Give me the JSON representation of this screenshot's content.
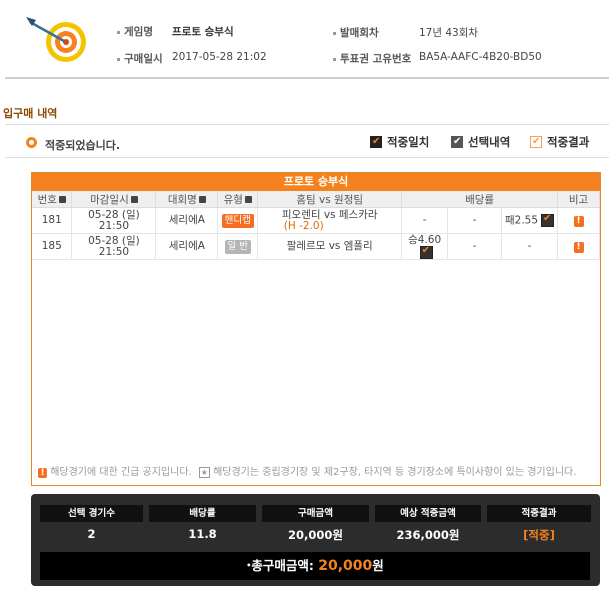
{
  "header": {
    "game_name_label": "게임명",
    "game_name": "프로토 승부식",
    "issue_label": "발매회차",
    "issue_value": "17년 43회차",
    "purchase_date_label": "구매일시",
    "purchase_date": "2017-05-28 21:02",
    "ticket_id_label": "투표권 고유번호",
    "ticket_id": "BA5A-AAFC-4B20-BD50"
  },
  "section": {
    "title": "입구매 내역",
    "status_text": "적중되었습니다."
  },
  "legend": {
    "hit_match": "적중일치",
    "selected": "선택내역",
    "hit_result": "적중결과",
    "colors": {
      "hit_match": "#222222",
      "selected": "#555555",
      "hit_result": "#f5a14f"
    }
  },
  "table": {
    "title": "프로토 승부식",
    "columns": [
      "번호",
      "마감일시",
      "대회명",
      "유형",
      "홈팀 vs 원정팀",
      "배당률",
      "비고"
    ],
    "rows": [
      {
        "no": "181",
        "date": "05-28 (일)",
        "time": "21:50",
        "league": "세리에A",
        "type": "핸디캡",
        "type_color": "#f36f21",
        "home": "피오렌티",
        "handicap": "(H -2.0)",
        "vs": "vs",
        "away": "페스카라",
        "odds_win": "-",
        "odds_draw": "-",
        "odds_lose": "패2.55",
        "selected_col": "lose"
      },
      {
        "no": "185",
        "date": "05-28 (일)",
        "time": "21:50",
        "league": "세리에A",
        "type": "일 반",
        "type_color": "#b5b5b5",
        "home": "팔레르모",
        "handicap": "",
        "vs": "vs",
        "away": "엠폴리",
        "odds_win": "승4.60",
        "odds_draw": "-",
        "odds_lose": "-",
        "selected_col": "win"
      }
    ],
    "notice1": "해당경기에 대한 긴급 공지입니다.",
    "notice2": "해당경기는 중립경기장 및 제2구장, 타지역 등 경기장소에 특이사항이 있는 경기입니다."
  },
  "summary": {
    "headers": [
      "선택 경기수",
      "배당률",
      "구매금액",
      "예상 적중금액",
      "적중결과"
    ],
    "values": [
      "2",
      "11.8",
      "20,000원",
      "236,000원",
      "[적중]"
    ],
    "total_label": "총구매금액:",
    "total_amount": "20,000",
    "total_unit": "원",
    "accent_color": "#f5821f"
  }
}
